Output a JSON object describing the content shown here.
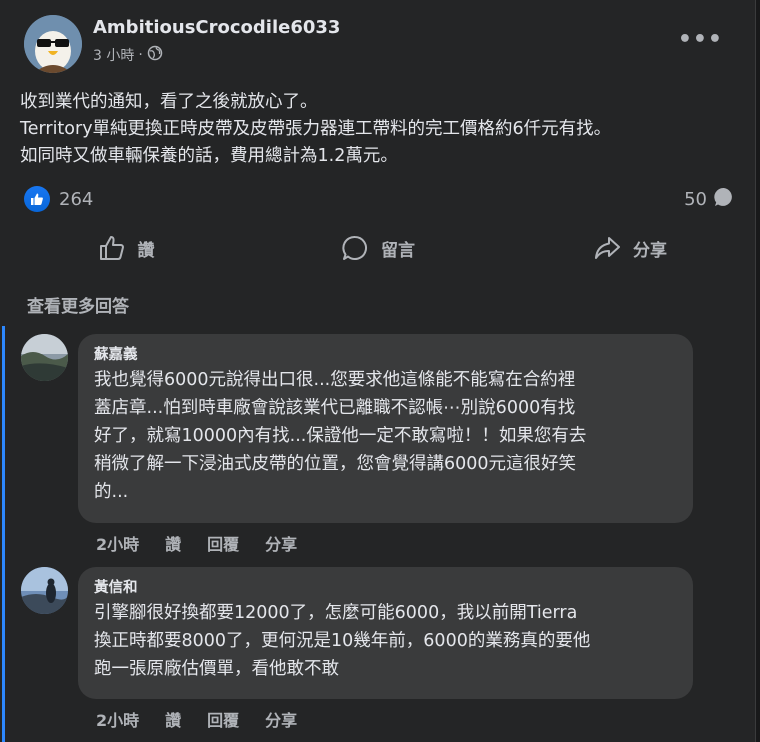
{
  "post": {
    "author": "AmbitiousCrocodile6033",
    "time": "3 小時",
    "dot": "·",
    "audience_icon": "globe-icon",
    "more_icon": "more-options-icon",
    "more_label": "•••",
    "body": [
      "收到業代的通知，看了之後就放心了。",
      "Territory單純更換正時皮帶及皮帶張力器連工帶料的完工價格約6仟元有找。",
      "如同時又做車輛保養的話，費用總計為1.2萬元。"
    ],
    "reaction_count": "264",
    "comment_count": "50"
  },
  "actions": {
    "like": "讚",
    "comment": "留言",
    "share": "分享"
  },
  "see_more_replies": "查看更多回答",
  "comments": [
    {
      "name": "蘇嘉義",
      "text": [
        "我也覺得6000元說得出口很...您要求他這條能不能寫在合約裡",
        "蓋店章...怕到時車廠會說該業代已離職不認帳⋯別說6000有找",
        "好了，就寫10000內有找...保證他一定不敢寫啦！！如果您有去",
        "稍微了解一下浸油式皮帶的位置，您會覺得講6000元這很好笑",
        "的..."
      ],
      "time": "2小時",
      "like": "讚",
      "reply": "回覆",
      "share": "分享"
    },
    {
      "name": "黃信和",
      "text": [
        "引擎腳很好換都要12000了，怎麼可能6000，我以前開Tierra",
        "換正時都要8000了，更何況是10幾年前，6000的業務真的要他",
        "跑一張原廠估價單，看他敢不敢"
      ],
      "time": "2小時",
      "like": "讚",
      "reply": "回覆",
      "share": "分享"
    }
  ],
  "colors": {
    "background": "#242526",
    "accent": "#2d88ff",
    "like_blue": "#1877f2",
    "bubble": "#3a3b3c",
    "secondary_text": "#b0b3b8"
  }
}
